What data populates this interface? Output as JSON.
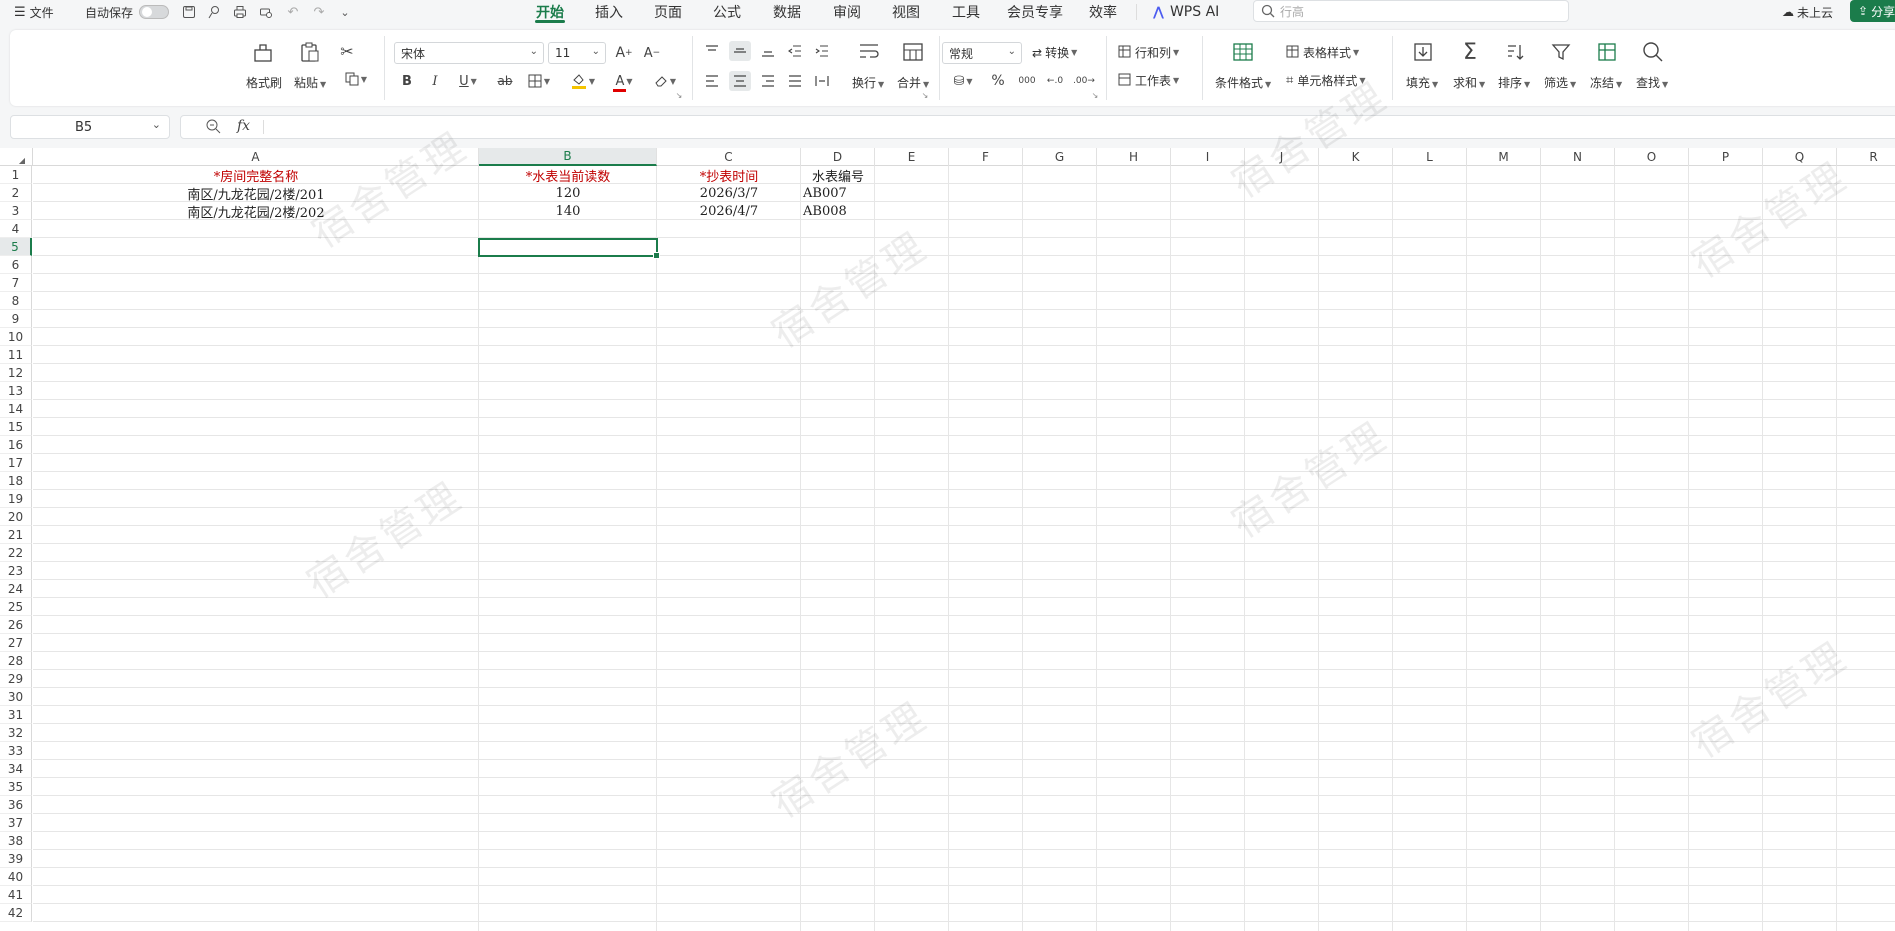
{
  "topbar": {
    "file_label": "文件",
    "autosave_label": "自动保存",
    "tabs": [
      "开始",
      "插入",
      "页面",
      "公式",
      "数据",
      "审阅",
      "视图",
      "工具",
      "会员专享",
      "效率"
    ],
    "active_tab": "开始",
    "wps_ai_label": "WPS AI",
    "search_placeholder": "行高",
    "cloud_label": "未上云",
    "share_label": "分享"
  },
  "ribbon": {
    "format_painter": "格式刷",
    "paste": "粘贴",
    "font_name": "宋体",
    "font_size": "11",
    "wrap": "换行",
    "merge": "合并",
    "number_format": "常规",
    "convert": "转换",
    "rows_cols": "行和列",
    "worksheet": "工作表",
    "cond_format": "条件格式",
    "table_style": "表格样式",
    "cell_style": "单元格样式",
    "fill": "填充",
    "sum": "求和",
    "sort": "排序",
    "filter": "筛选",
    "freeze": "冻结",
    "find": "查找",
    "bold": "B",
    "italic": "I",
    "underline": "U",
    "strike": "ab",
    "font_color_letter": "A",
    "percent": "%",
    "thousands": "000"
  },
  "formula_bar": {
    "cell_ref": "B5",
    "fx": "fx",
    "content": ""
  },
  "sheet": {
    "columns": [
      "A",
      "B",
      "C",
      "D",
      "E",
      "F",
      "G",
      "H",
      "I",
      "J",
      "K",
      "L",
      "M",
      "N",
      "O",
      "P",
      "Q",
      "R"
    ],
    "selected_column": "B",
    "selected_row": 5,
    "row_count": 42,
    "headers": {
      "A1": "*房间完整名称",
      "B1": "*水表当前读数",
      "C1": "*抄表时间",
      "D1": "水表编号"
    },
    "rows": [
      {
        "room": "南区/九龙花园/2楼/201",
        "reading": "120",
        "date": "2026/3/7",
        "meter_no": "AB007"
      },
      {
        "room": "南区/九龙花园/2楼/202",
        "reading": "140",
        "date": "2026/4/7",
        "meter_no": "AB008"
      }
    ]
  },
  "watermark_text": "宿舍管理",
  "colors": {
    "accent": "#1b7c4b",
    "required_header": "#c00000"
  }
}
